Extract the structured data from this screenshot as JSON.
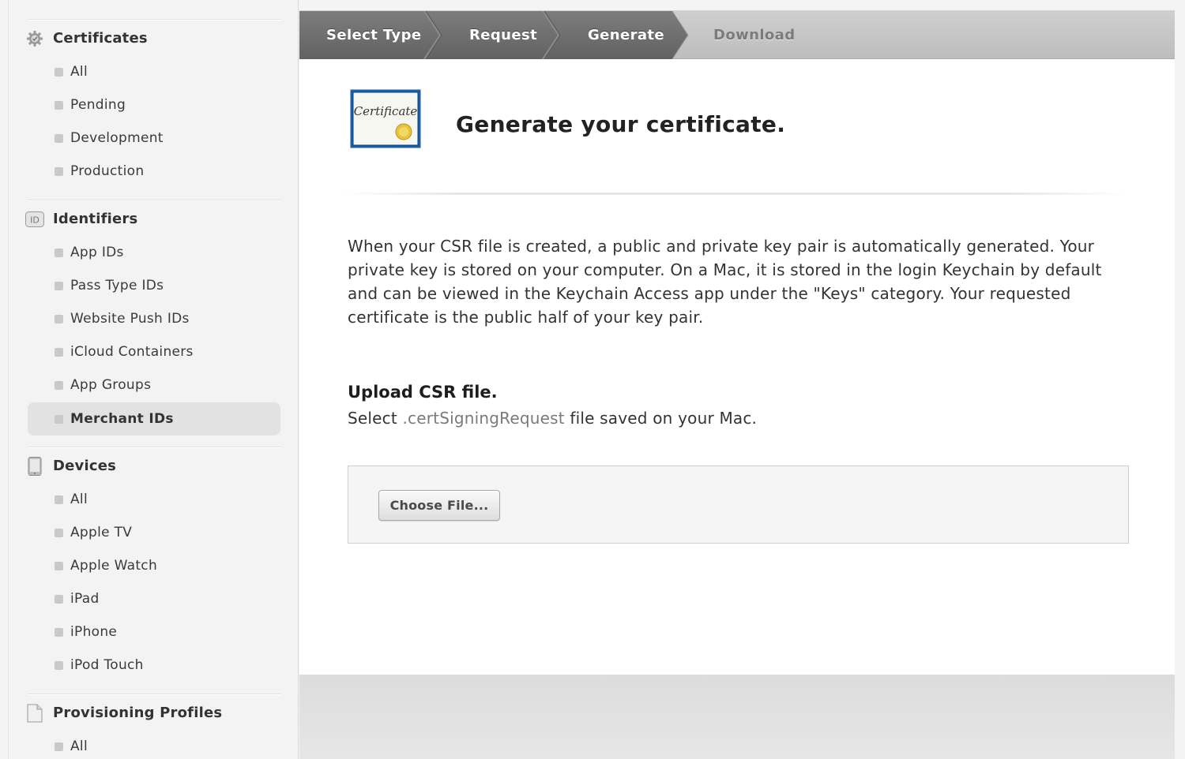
{
  "sidebar": {
    "sections": [
      {
        "title": "Certificates",
        "icon": "certificate-gear-icon",
        "items": [
          "All",
          "Pending",
          "Development",
          "Production"
        ]
      },
      {
        "title": "Identifiers",
        "icon": "id-badge-icon",
        "icon_text": "ID",
        "items": [
          "App IDs",
          "Pass Type IDs",
          "Website Push IDs",
          "iCloud Containers",
          "App Groups",
          "Merchant IDs"
        ]
      },
      {
        "title": "Devices",
        "icon": "device-icon",
        "items": [
          "All",
          "Apple TV",
          "Apple Watch",
          "iPad",
          "iPhone",
          "iPod Touch"
        ]
      },
      {
        "title": "Provisioning Profiles",
        "icon": "document-icon",
        "items": [
          "All"
        ]
      }
    ],
    "selected_item": "Merchant IDs"
  },
  "steps": {
    "labels": [
      "Select Type",
      "Request",
      "Generate",
      "Download"
    ],
    "current": "Generate"
  },
  "main": {
    "icon": "certificate-icon",
    "icon_text": "Certificate",
    "title": "Generate your certificate.",
    "description": "When your CSR file is created, a public and private key pair is automatically generated. Your private key is stored on your computer. On a Mac, it is stored in the login Keychain by default and can be viewed in the Keychain Access app under the \"Keys\" category. Your requested certificate is the public half of your key pair.",
    "upload_heading": "Upload CSR file.",
    "upload_instruction_prefix": "Select",
    "upload_instruction_ext": ".certSigningRequest",
    "upload_instruction_suffix": "file saved on your Mac.",
    "choose_file_label": "Choose File..."
  },
  "colors": {
    "steps_done": "#6f6f6f",
    "steps_todo": "#c6c6c6",
    "selected_item_bg": "#e2e2e2",
    "certificate_border": "#1d5fa6",
    "seal": "#e7c43a"
  }
}
